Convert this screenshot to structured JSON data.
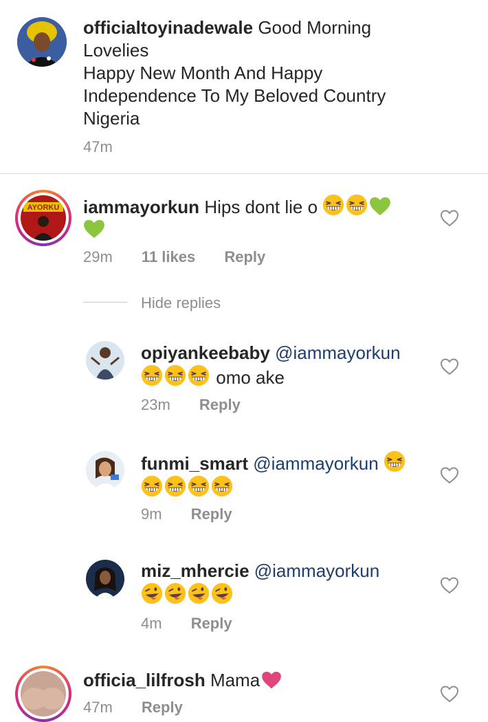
{
  "post": {
    "username": "officialtoyinadewale",
    "caption_lines": [
      "Good Morning",
      "Lovelies",
      "Happy New Month And Happy",
      "Independence To My Beloved Country",
      "Nigeria"
    ],
    "time": "47m"
  },
  "comments": [
    {
      "username": "iammayorkun",
      "text": "Hips dont lie o",
      "time": "29m",
      "likes": "11 likes",
      "reply_label": "Reply",
      "hide_replies_label": "Hide replies",
      "replies": [
        {
          "username": "opiyankeebaby",
          "mention": "@iammayorkun",
          "text": "omo ake",
          "time": "23m",
          "reply_label": "Reply"
        },
        {
          "username": "funmi_smart",
          "mention": "@iammayorkun",
          "text": "",
          "time": "9m",
          "reply_label": "Reply"
        },
        {
          "username": "miz_mhercie",
          "mention": "@iammayorkun",
          "text": "",
          "time": "4m",
          "reply_label": "Reply"
        }
      ]
    },
    {
      "username": "officia_lilfrosh",
      "text": "Mama",
      "time": "47m",
      "reply_label": "Reply"
    }
  ],
  "icons": {
    "heart_outline": "heart-outline-icon",
    "grin_emoji": "grinning-squinting-face",
    "wink_emoji": "winking-face-with-tongue",
    "green_heart": "green-heart",
    "pink_heart": "pink-heart"
  },
  "colors": {
    "username": "#262626",
    "meta": "#8e8e8e",
    "mention": "#1c3f6e",
    "divider": "#dbdbdb",
    "green_heart": "#8cc63f",
    "pink_heart": "#e0457b",
    "emoji_yellow": "#fcc21b"
  }
}
